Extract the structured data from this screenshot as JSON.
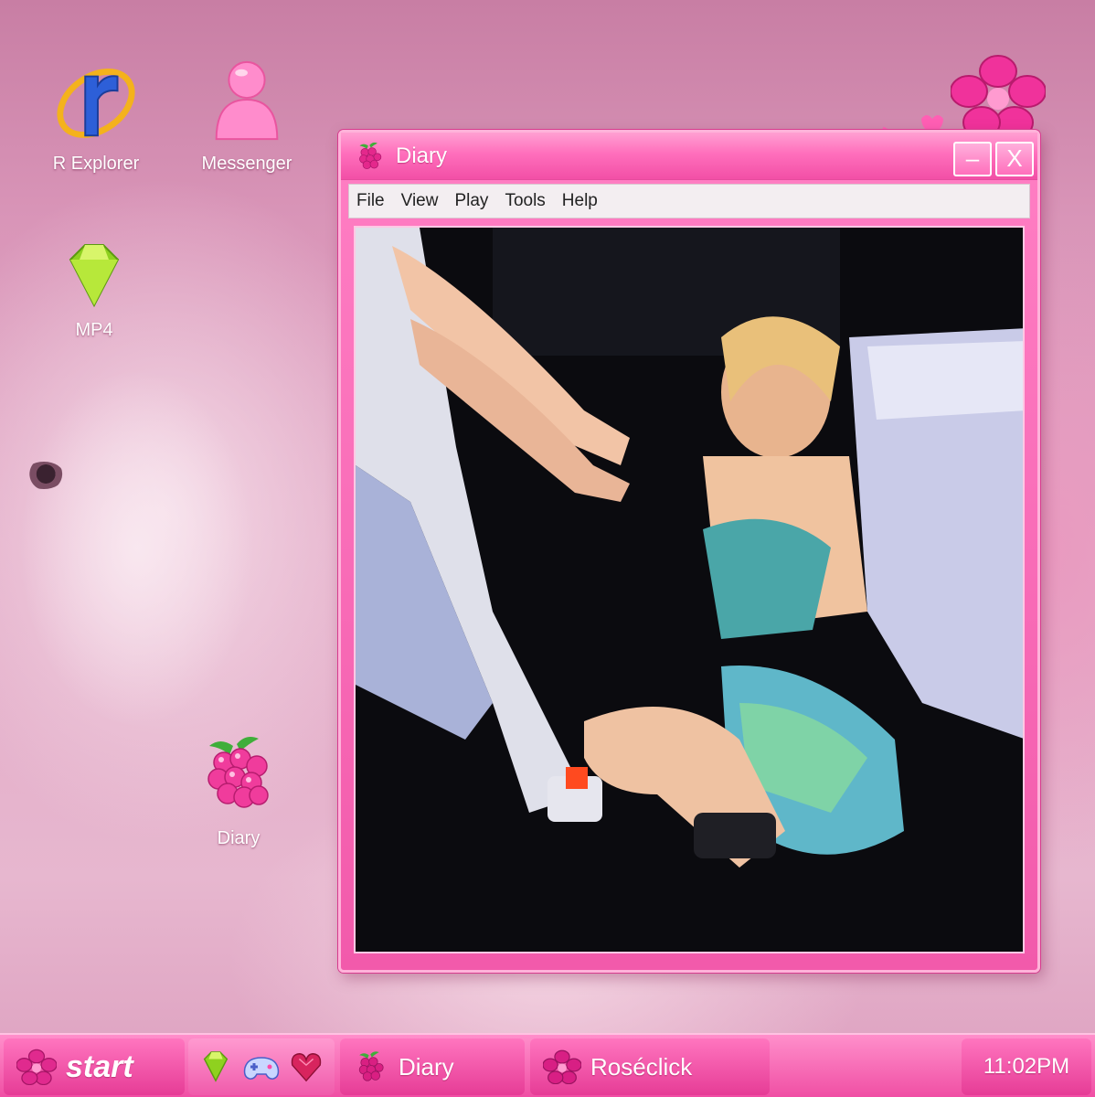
{
  "desktop": {
    "icons": [
      {
        "label": "R Explorer"
      },
      {
        "label": "Messenger"
      },
      {
        "label": "MP4"
      },
      {
        "label": "Diary"
      }
    ]
  },
  "window": {
    "title": "Diary",
    "minimize_symbol": "–",
    "close_symbol": "X",
    "menu": [
      "File",
      "View",
      "Play",
      "Tools",
      "Help"
    ],
    "content_icon": "photo-image"
  },
  "taskbar": {
    "start_label": "start",
    "tasks": [
      {
        "label": "Diary"
      },
      {
        "label": "Roséclick"
      }
    ],
    "clock": "11:02PM"
  },
  "colors": {
    "accent": "#f24fa6",
    "accent_light": "#ff9fd2",
    "menu_bg": "#f3eef1"
  }
}
